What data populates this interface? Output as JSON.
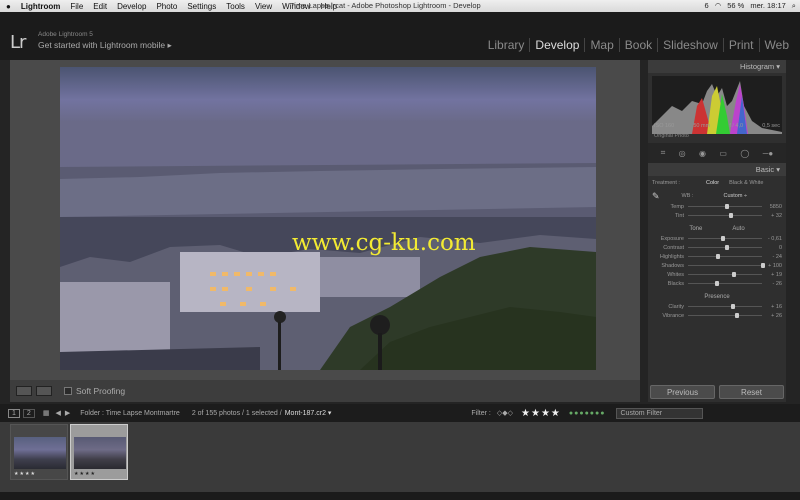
{
  "menubar": {
    "apple": "",
    "app": "Lightroom",
    "items": [
      "File",
      "Edit",
      "Develop",
      "Photo",
      "Settings",
      "Tools",
      "View",
      "Window",
      "Help"
    ],
    "title": "Time Lapse.lrcat - Adobe Photoshop Lightroom - Develop",
    "count": "6",
    "battery": "56 %",
    "flag": "▮▮",
    "clock": "mer. 18:17"
  },
  "header": {
    "logo": "Lr",
    "version": "Adobe Lightroom 5",
    "mobile": "Get started with Lightroom mobile ▸",
    "modules": [
      "Library",
      "Develop",
      "Map",
      "Book",
      "Slideshow",
      "Print",
      "Web"
    ],
    "active": "Develop"
  },
  "watermark": "www.cg-ku.com",
  "toolbar": {
    "soft_proofing": "Soft Proofing"
  },
  "panel": {
    "histogram_title": "Histogram ▾",
    "iso": "ISO 160",
    "focal": "50 mm",
    "aperture": "f / 4,0",
    "shutter": "0,5 sec",
    "original_photo": "Original Photo",
    "basic_title": "Basic ▾",
    "treatment_label": "Treatment :",
    "color": "Color",
    "bw": "Black & White",
    "wb_label": "WB :",
    "wb_value": "Custom ÷",
    "tone_label": "Tone",
    "auto": "Auto",
    "presence_label": "Presence",
    "wb_sliders": [
      {
        "label": "Temp",
        "value": "5850",
        "pos": 0.5
      },
      {
        "label": "Tint",
        "value": "+ 32",
        "pos": 0.55
      }
    ],
    "tone_sliders": [
      {
        "label": "Exposure",
        "value": "- 0,61",
        "pos": 0.44
      },
      {
        "label": "Contrast",
        "value": "0",
        "pos": 0.5
      },
      {
        "label": "Highlights",
        "value": "- 24",
        "pos": 0.38
      },
      {
        "label": "Shadows",
        "value": "+ 100",
        "pos": 0.98
      },
      {
        "label": "Whites",
        "value": "+ 19",
        "pos": 0.6
      },
      {
        "label": "Blacks",
        "value": "- 26",
        "pos": 0.37
      }
    ],
    "presence_sliders": [
      {
        "label": "Clarity",
        "value": "+ 16",
        "pos": 0.58
      },
      {
        "label": "Vibrance",
        "value": "+ 26",
        "pos": 0.63
      }
    ],
    "previous": "Previous",
    "reset": "Reset"
  },
  "filmstrip": {
    "pages": [
      "1",
      "2"
    ],
    "folder": "Folder : Time Lapse Montmartre",
    "count": "2 of 155 photos / 1 selected /",
    "file": "Mont-187.cr2 ▾",
    "filter_label": "Filter :",
    "rating": "★★★★",
    "custom_filter": "Custom Filter",
    "thumb_stars": "★★★★"
  }
}
